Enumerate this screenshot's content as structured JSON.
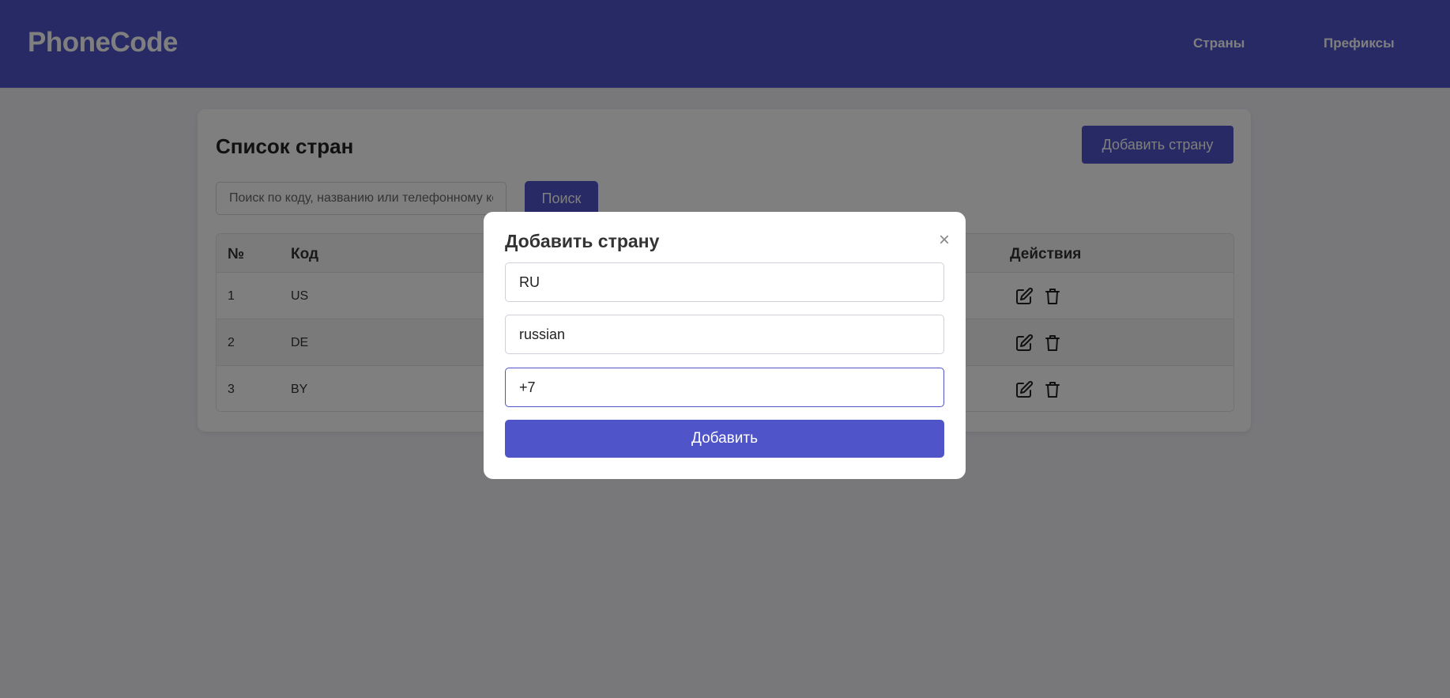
{
  "header": {
    "logo": "PhoneCode",
    "nav": [
      {
        "label": "Страны"
      },
      {
        "label": "Префиксы"
      }
    ]
  },
  "main": {
    "title": "Список стран",
    "add_button": "Добавить страну",
    "search": {
      "placeholder": "Поиск по коду, названию или телефонному коду",
      "value": "",
      "button": "Поиск"
    },
    "table": {
      "columns": [
        "№",
        "Код",
        "Действия"
      ],
      "rows": [
        {
          "num": "1",
          "code": "US"
        },
        {
          "num": "2",
          "code": "DE"
        },
        {
          "num": "3",
          "code": "BY"
        }
      ],
      "row_actions": [
        "edit-icon",
        "trash-icon"
      ]
    }
  },
  "modal": {
    "title": "Добавить страну",
    "close": "×",
    "fields": {
      "code": "RU",
      "name": "russian",
      "phone": "+7"
    },
    "submit": "Добавить"
  },
  "colors": {
    "primary": "#4f54c9",
    "overlay": "rgba(0,0,0,0.5)"
  }
}
